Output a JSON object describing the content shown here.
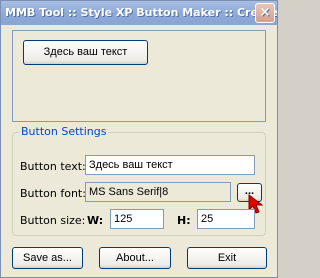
{
  "window": {
    "title": "MMB Tool :: Style XP Button Maker :: Create...",
    "close_glyph": "×"
  },
  "preview": {
    "button_text": "Здесь ваш текст"
  },
  "settings": {
    "legend": "Button Settings",
    "text_label": "Button text:",
    "text_value": "Здесь ваш текст",
    "font_label": "Button font:",
    "font_value": "MS Sans Serif|8",
    "browse_label": "...",
    "size_label": "Button size:",
    "width_label": "W:",
    "width_value": "125",
    "height_label": "H:",
    "height_value": "25"
  },
  "actions": {
    "save_label": "Save as...",
    "about_label": "About...",
    "exit_label": "Exit"
  },
  "colors": {
    "accent": "#0046d5",
    "cursor": "#e00000"
  },
  "icons": {
    "cursor": "mouse-pointer-icon"
  }
}
